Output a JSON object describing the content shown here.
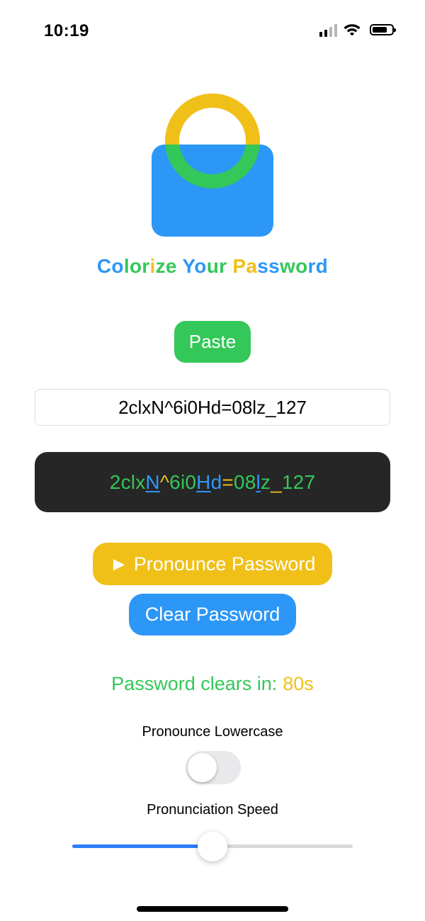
{
  "status_bar": {
    "time": "10:19"
  },
  "title": {
    "segments": [
      {
        "text": "Colorize",
        "color": "#2c97f7"
      },
      {
        "text": " ",
        "color": "#2c97f7"
      },
      {
        "text": "Your",
        "color": "#2c97f7"
      },
      {
        "text": " ",
        "color": "#2c97f7"
      },
      {
        "text": "Password",
        "color": "#2c97f7"
      }
    ],
    "full_text": "Colorize Your Password"
  },
  "paste_button": {
    "label": "Paste"
  },
  "password_input": {
    "value": "2clxN^6i0Hd=08lz_127",
    "placeholder": ""
  },
  "colorized_password": {
    "characters": [
      {
        "char": "2",
        "type": "digit"
      },
      {
        "char": "c",
        "type": "lower"
      },
      {
        "char": "l",
        "type": "lower"
      },
      {
        "char": "x",
        "type": "lower"
      },
      {
        "char": "N",
        "type": "upper"
      },
      {
        "char": "^",
        "type": "symbol"
      },
      {
        "char": "6",
        "type": "digit"
      },
      {
        "char": "i",
        "type": "lower"
      },
      {
        "char": "0",
        "type": "digit"
      },
      {
        "char": "H",
        "type": "upper"
      },
      {
        "char": "d",
        "type": "upper-plain"
      },
      {
        "char": "=",
        "type": "symbol"
      },
      {
        "char": "0",
        "type": "digit"
      },
      {
        "char": "8",
        "type": "digit"
      },
      {
        "char": "l",
        "type": "upper"
      },
      {
        "char": "z",
        "type": "lower"
      },
      {
        "char": "_",
        "type": "symbol"
      },
      {
        "char": "1",
        "type": "digit"
      },
      {
        "char": "2",
        "type": "digit"
      },
      {
        "char": "7",
        "type": "digit"
      }
    ]
  },
  "pronounce_button": {
    "label": "► Pronounce Password"
  },
  "clear_button": {
    "label": "Clear Password"
  },
  "timer": {
    "label": "Password clears in:",
    "value": "80s"
  },
  "pronounce_lowercase": {
    "label": "Pronounce Lowercase",
    "enabled": false
  },
  "pronunciation_speed": {
    "label": "Pronunciation Speed",
    "value_fraction": 0.5
  },
  "colors": {
    "green": "#34c759",
    "blue": "#2c97f7",
    "yellow": "#f0c019",
    "dark_box": "#262626"
  }
}
